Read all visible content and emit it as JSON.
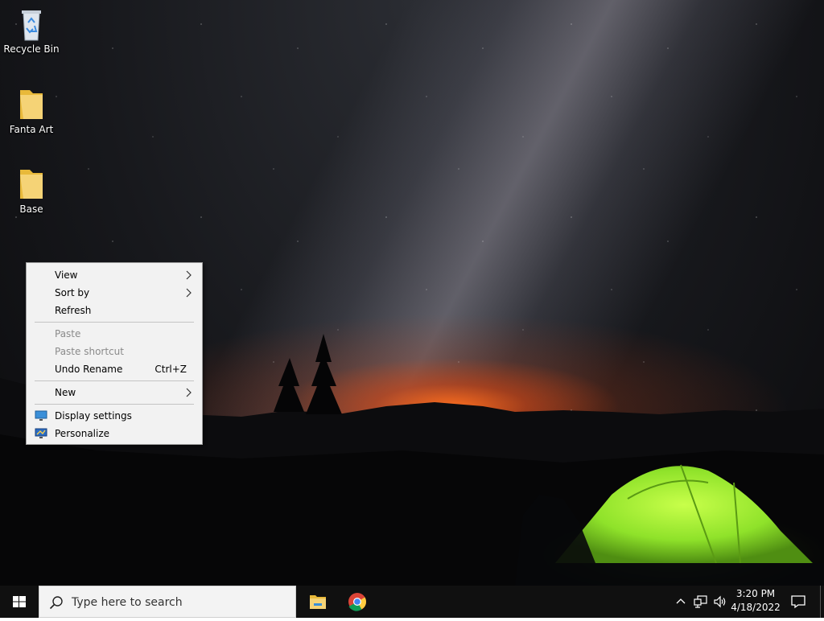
{
  "desktop": {
    "icons": [
      {
        "label": "Recycle Bin",
        "icon": "recycle-bin-icon"
      },
      {
        "label": "Fanta Art",
        "icon": "folder-icon"
      },
      {
        "label": "Base",
        "icon": "folder-icon"
      }
    ]
  },
  "context_menu": {
    "view": "View",
    "sort_by": "Sort by",
    "refresh": "Refresh",
    "paste": "Paste",
    "paste_shortcut": "Paste shortcut",
    "undo_rename": "Undo Rename",
    "undo_rename_shortcut": "Ctrl+Z",
    "new": "New",
    "display_settings": "Display settings",
    "personalize": "Personalize"
  },
  "taskbar": {
    "search_placeholder": "Type here to search",
    "apps": [
      "file-explorer-icon",
      "chrome-icon"
    ],
    "time": "3:20 PM",
    "date": "4/18/2022"
  },
  "colors": {
    "taskbar": "#101010",
    "menu_bg": "#f2f2f2",
    "folder": "#f5d376",
    "tent": "#8fe22a",
    "horizon_glow": "#ff6e1e"
  }
}
